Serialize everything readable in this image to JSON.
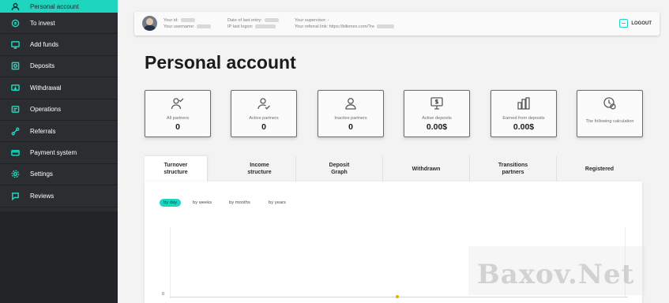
{
  "sidebar": {
    "items": [
      {
        "label": "Personal account",
        "icon": "user-icon",
        "active": true
      },
      {
        "label": "To invest",
        "icon": "coin-icon"
      },
      {
        "label": "Add funds",
        "icon": "wallet-icon"
      },
      {
        "label": "Deposits",
        "icon": "deposit-icon"
      },
      {
        "label": "Withdrawal",
        "icon": "withdraw-icon"
      },
      {
        "label": "Operations",
        "icon": "operations-icon"
      },
      {
        "label": "Referrals",
        "icon": "referrals-icon"
      },
      {
        "label": "Payment system",
        "icon": "payment-icon"
      },
      {
        "label": "Settings",
        "icon": "gear-icon"
      },
      {
        "label": "Reviews",
        "icon": "chat-icon"
      }
    ]
  },
  "topbar": {
    "id_label": "Your id:",
    "username_label": "Your username:",
    "last_entry_label": "Date of last entry:",
    "last_logon_label": "IP last logon:",
    "supervisor_label": "Your supervisor: -",
    "referral_label": "Your referral link: https://bilionex.com/?re",
    "logout_label": "LOGOUT"
  },
  "page": {
    "title": "Personal account"
  },
  "cards": [
    {
      "label": "All partners",
      "value": "0",
      "icon": "partners-icon"
    },
    {
      "label": "Active partners",
      "value": "0",
      "icon": "active-partner-icon"
    },
    {
      "label": "Inactive partners",
      "value": "0",
      "icon": "inactive-partner-icon"
    },
    {
      "label": "Active deposits",
      "value": "0.00$",
      "icon": "monitor-dollar-icon"
    },
    {
      "label": "Earned from deposits",
      "value": "0.00$",
      "icon": "coins-stack-icon"
    },
    {
      "label": "The following calculation",
      "value": "",
      "icon": "clock-coin-icon"
    }
  ],
  "tabs": [
    {
      "label": "Turnover structure",
      "active": true
    },
    {
      "label": "Income structure"
    },
    {
      "label": "Deposit Graph"
    },
    {
      "label": "Withdrawn"
    },
    {
      "label": "Transitions partners"
    },
    {
      "label": "Registered"
    }
  ],
  "chart": {
    "periods": [
      "by day",
      "by weeks",
      "by months",
      "by years"
    ],
    "active_period": "by day",
    "y_zero_label": "0"
  },
  "chart_data": {
    "type": "line",
    "title": "",
    "xlabel": "",
    "ylabel": "",
    "series": [
      {
        "values": [
          0
        ]
      }
    ],
    "ylim": [
      0,
      0
    ]
  },
  "watermark": "Baxov.Net",
  "colors": {
    "accent": "#1ed6bd",
    "sidebar": "#2b2d30",
    "point": "#e2b100"
  }
}
